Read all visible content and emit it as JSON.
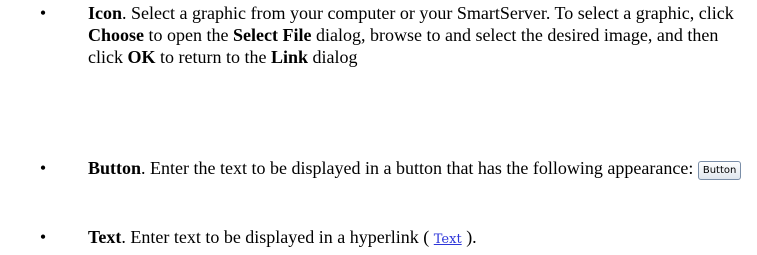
{
  "items": [
    {
      "term": "Icon",
      "p1": ".  Select a graphic from your computer or your SmartServer. To select a graphic, click ",
      "b1": "Choose",
      "p2": " to open the ",
      "b2": "Select File",
      "p3": " dialog, browse to and select the desired image, and then click ",
      "b3": "OK",
      "p4": " to return to the ",
      "b4": "Link",
      "p5": " dialog"
    },
    {
      "term": "Button",
      "p1": ".  Enter the text to be displayed in a button that has the following appearance: ",
      "sample_label": "Button"
    },
    {
      "term": "Text",
      "p1": ".  Enter text to be displayed in a hyperlink ( ",
      "sample_link": "Text",
      "p2": " )."
    }
  ],
  "bullet_glyph": "•"
}
